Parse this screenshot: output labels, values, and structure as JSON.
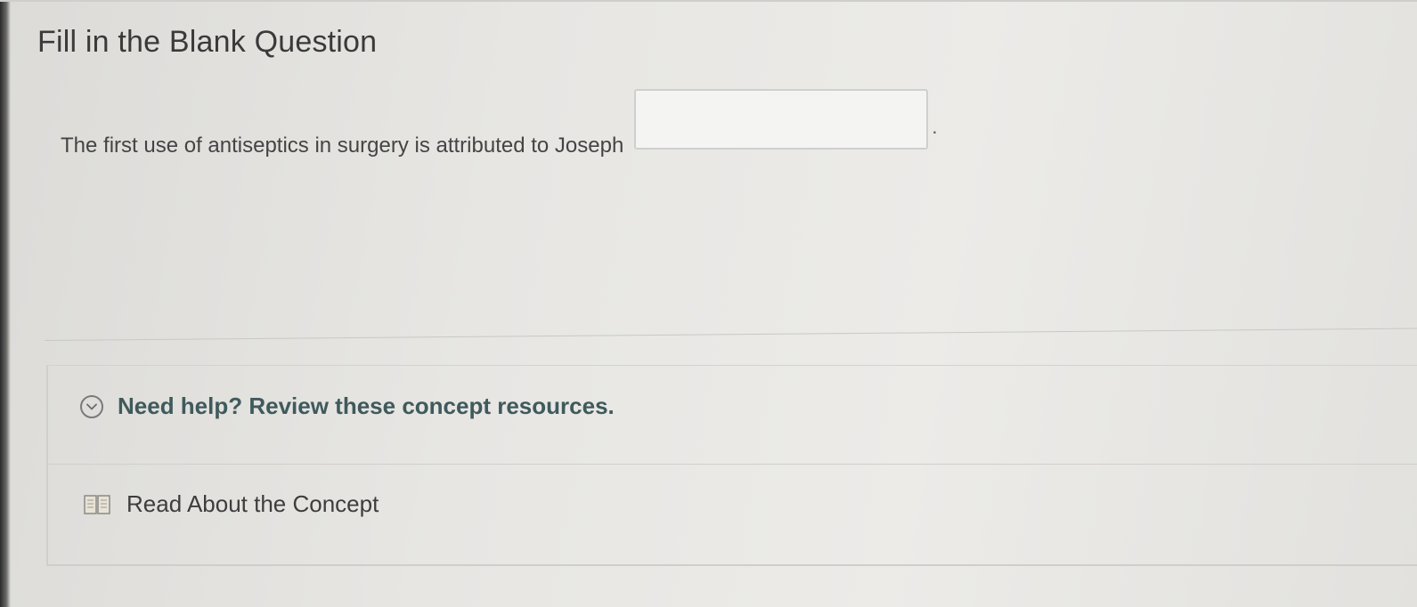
{
  "page": {
    "title": "Fill in the Blank Question"
  },
  "question": {
    "text": "The first use of antiseptics in surgery is attributed to Joseph",
    "blank_value": "",
    "trailing": "."
  },
  "resources": {
    "help_label": "Need help? Review these concept resources.",
    "help_icon": "chevron-down-circle-icon",
    "items": [
      {
        "label": "Read About the Concept",
        "icon": "book-icon"
      }
    ]
  },
  "colors": {
    "help_text": "#3f5a5c",
    "body_text": "#3d3d3d"
  }
}
